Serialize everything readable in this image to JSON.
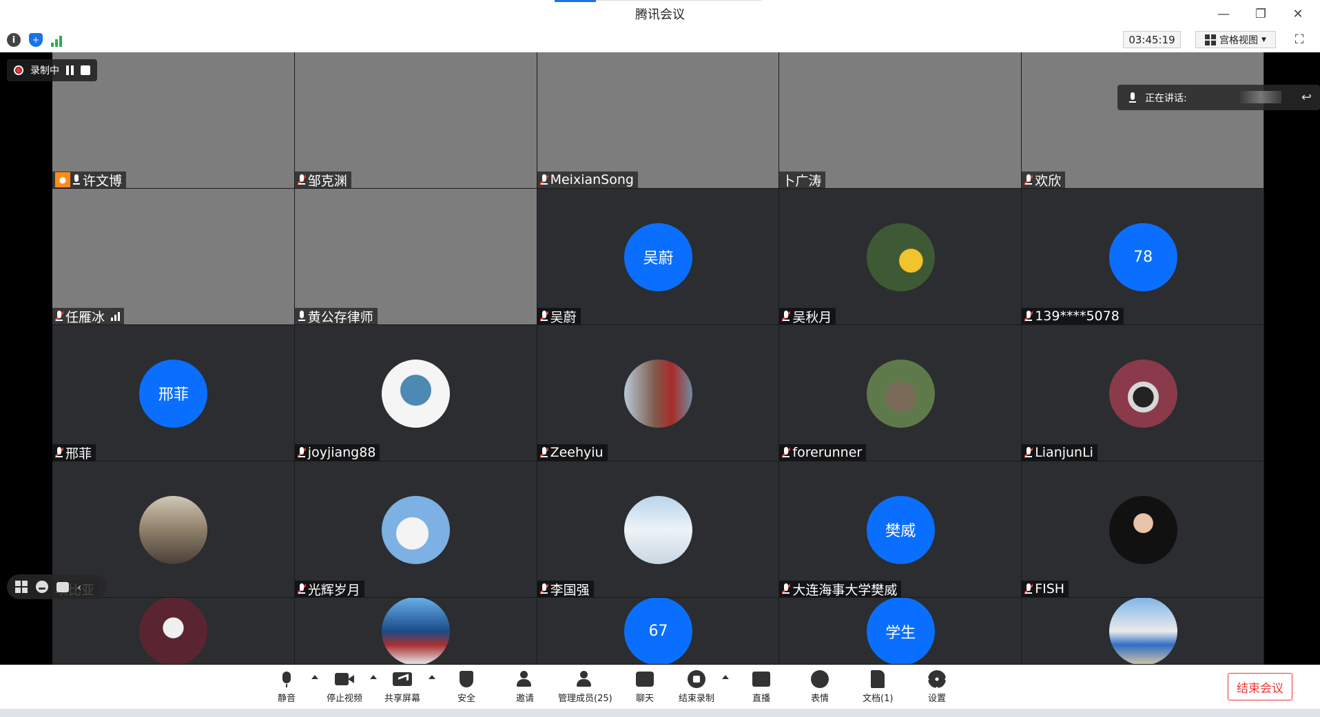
{
  "window": {
    "title": "腾讯会议",
    "minimize": "—",
    "restore": "❐",
    "close": "✕"
  },
  "info_bar": {
    "timer": "03:45:19",
    "view_label": "宫格视图"
  },
  "recording": {
    "label": "录制中"
  },
  "speaking": {
    "label": "正在讲话:"
  },
  "participants": [
    {
      "name": "许文博",
      "video": "v1",
      "host": true
    },
    {
      "name": "邹克渊",
      "video": "v2",
      "muted": true
    },
    {
      "name": "MeixianSong",
      "video": "v3",
      "muted": true
    },
    {
      "name": "卜广涛",
      "video": "v4"
    },
    {
      "name": "欢欣",
      "video": "v5",
      "muted": true
    },
    {
      "name": "任雁冰",
      "video": "v6",
      "muted": true,
      "signal": true
    },
    {
      "name": "黄公存律师",
      "video": "v7",
      "mic": true
    },
    {
      "name": "吴蔚",
      "avatar_text": "吴蔚",
      "muted": true
    },
    {
      "name": "吴秋月",
      "avatar_photo": "p-a1",
      "muted": true
    },
    {
      "name": "139****5078",
      "avatar_text": "78",
      "muted": true
    },
    {
      "name": "邢菲",
      "avatar_text": "邢菲",
      "muted": true
    },
    {
      "name": "joyjiang88",
      "avatar_photo": "p-a2",
      "muted": true
    },
    {
      "name": "Zeehyiu",
      "avatar_photo": "p-a3",
      "muted": true
    },
    {
      "name": "forerunner",
      "avatar_photo": "p-a4",
      "muted": true
    },
    {
      "name": "LianjunLi",
      "avatar_photo": "p-a5",
      "muted": true
    },
    {
      "name": "坎比亚",
      "avatar_photo": "p-a6"
    },
    {
      "name": "光辉岁月",
      "avatar_photo": "p-a7",
      "muted": true
    },
    {
      "name": "李国强",
      "avatar_photo": "p-a8",
      "muted": true
    },
    {
      "name": "大连海事大学樊威",
      "avatar_text": "樊威",
      "muted": true
    },
    {
      "name": "FISH",
      "avatar_photo": "p-a9",
      "muted": true
    },
    {
      "name": "",
      "avatar_photo": "p-a10"
    },
    {
      "name": "",
      "avatar_photo": "p-a11"
    },
    {
      "name": "",
      "avatar_text": "67"
    },
    {
      "name": "",
      "avatar_text": "学生"
    },
    {
      "name": "",
      "avatar_photo": "p-a12"
    }
  ],
  "toolbar": {
    "mute": "静音",
    "stop_video": "停止视频",
    "share_screen": "共享屏幕",
    "security": "安全",
    "invite": "邀请",
    "manage_members": "管理成员(25)",
    "chat": "聊天",
    "end_recording": "结束录制",
    "live": "直播",
    "reactions": "表情",
    "documents": "文档(1)",
    "settings": "设置",
    "end_meeting": "结束会议"
  },
  "colors": {
    "accent": "#0a6fff",
    "end": "#ee3333",
    "tile_bg": "#2b2d30"
  }
}
